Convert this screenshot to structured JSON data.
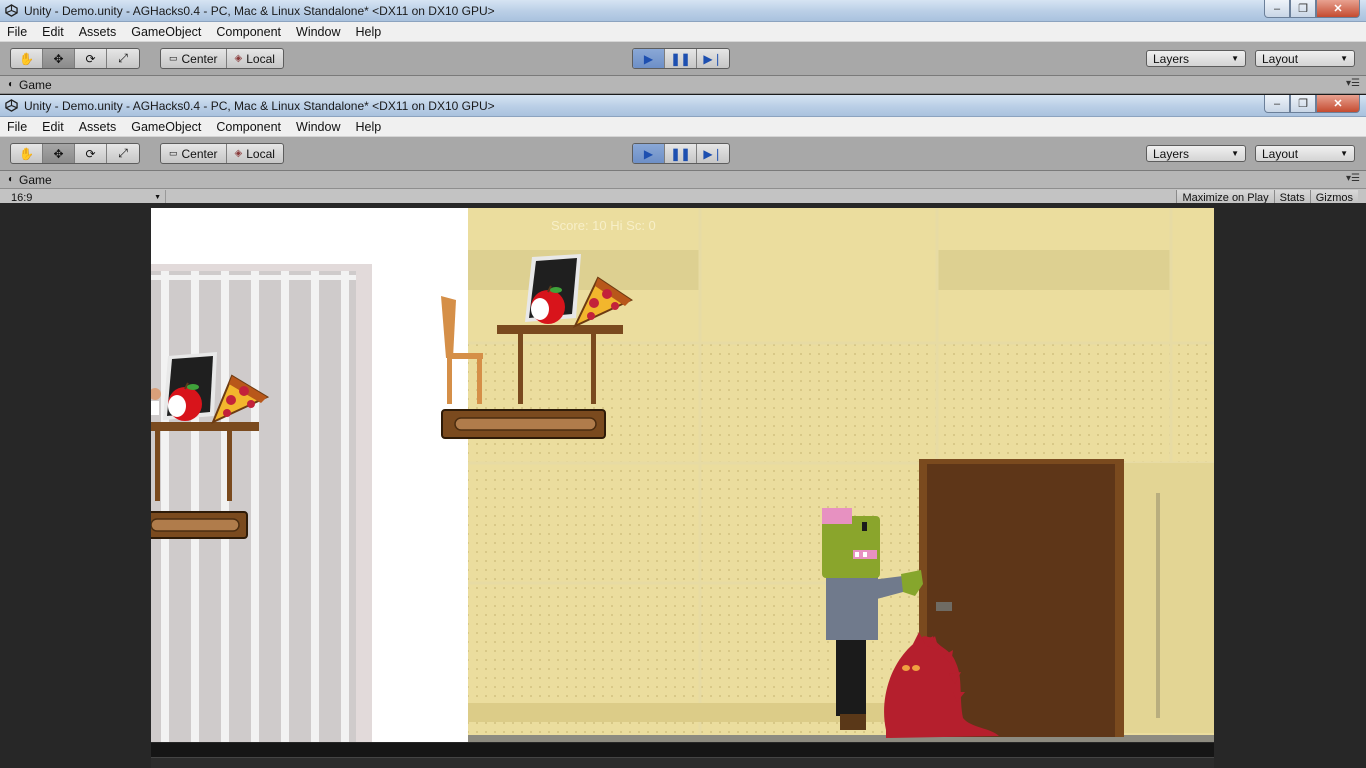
{
  "window_title": "Unity - Demo.unity - AGHacks0.4 - PC, Mac & Linux Standalone* <DX11 on DX10 GPU>",
  "window_buttons": {
    "minimize": "‒",
    "maximize": "❐",
    "close": "✕"
  },
  "menu": [
    "File",
    "Edit",
    "Assets",
    "GameObject",
    "Component",
    "Window",
    "Help"
  ],
  "toolbar": {
    "tools": [
      "hand-icon",
      "move-icon",
      "rotate-icon",
      "scale-icon"
    ],
    "pivot_center": "Center",
    "pivot_local": "Local",
    "play_controls": [
      "play-icon",
      "pause-icon",
      "step-icon"
    ],
    "layers_label": "Layers",
    "layout_label": "Layout"
  },
  "game_tab": {
    "label": "Game"
  },
  "game_bar": {
    "aspect": "16:9",
    "maximize_on_play": "Maximize on Play",
    "stats": "Stats",
    "gizmos": "Gizmos"
  },
  "scene": {
    "score_text": "Score: 10 Hi Sc: 0",
    "colors": {
      "wall": "#ebdd9e",
      "door": "#5e3618",
      "shelf_brown": "#7a4a1e",
      "monster_red": "#b51f2d",
      "zombie_green": "#8aa52c",
      "zombie_shirt": "#707a8c"
    }
  }
}
